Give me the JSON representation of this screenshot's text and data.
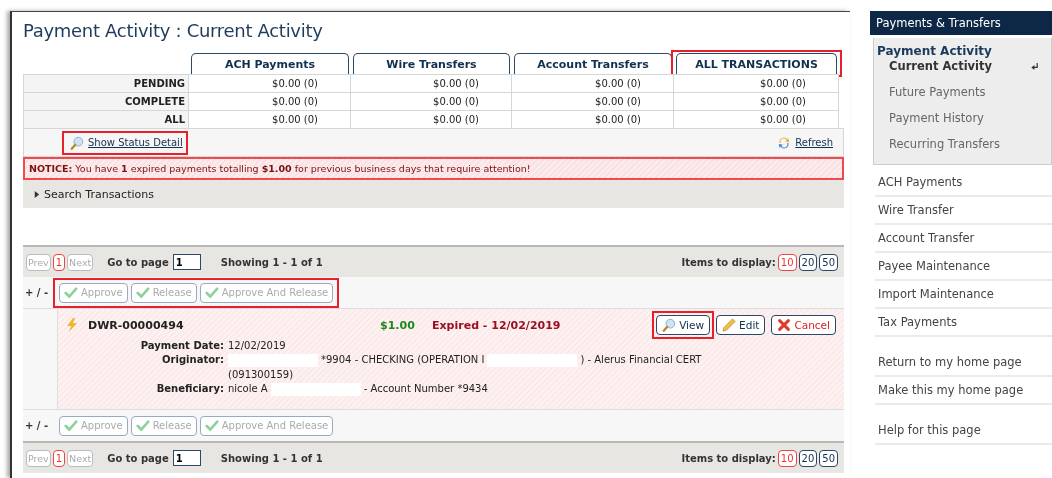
{
  "title": "Payment Activity : Current Activity",
  "summary": {
    "columns": [
      {
        "label": "ACH Payments",
        "highlighted": false
      },
      {
        "label": "Wire Transfers",
        "highlighted": false
      },
      {
        "label": "Account Transfers",
        "highlighted": false
      },
      {
        "label": "ALL TRANSACTIONS",
        "highlighted": true
      }
    ],
    "rows": [
      {
        "label": "PENDING",
        "cells": [
          "$0.00 (0)",
          "$0.00 (0)",
          "$0.00 (0)",
          "$0.00 (0)"
        ]
      },
      {
        "label": "COMPLETE",
        "cells": [
          "$0.00 (0)",
          "$0.00 (0)",
          "$0.00 (0)",
          "$0.00 (0)"
        ]
      },
      {
        "label": "ALL",
        "cells": [
          "$0.00 (0)",
          "$0.00 (0)",
          "$0.00 (0)",
          "$0.00 (0)"
        ]
      }
    ]
  },
  "status_link": {
    "label": "Show Status Detail",
    "highlighted": true
  },
  "refresh": "Refresh",
  "notice": "**NOTICE:** You have **1** expired payments totalling **$1.00** for previous business days that require attention!",
  "search": {
    "label": "Search Transactions",
    "expanded": false
  },
  "pager_top": {
    "pages": [
      {
        "label": "Prev",
        "kind": "nav",
        "disabled": true,
        "selected": false
      },
      {
        "label": "1",
        "kind": "page",
        "disabled": false,
        "selected": true
      },
      {
        "label": "Next",
        "kind": "nav",
        "disabled": true,
        "selected": false
      }
    ],
    "goto_label": "Go to page",
    "goto_value": "1",
    "showing": "Showing 1 - 1 of 1",
    "items_label": "Items to display:",
    "sizes": [
      {
        "label": "10",
        "selected": true
      },
      {
        "label": "20",
        "selected": false
      },
      {
        "label": "50",
        "selected": false
      }
    ]
  },
  "actions_top": {
    "toggle": "+ / -",
    "highlighted": true,
    "buttons": [
      {
        "label": "Approve",
        "disabled": true
      },
      {
        "label": "Release",
        "disabled": true
      },
      {
        "label": "Approve And Release",
        "disabled": true
      }
    ]
  },
  "payment": {
    "id": "DWR-00000494",
    "amount": "$1.00",
    "status": "Expired - 12/02/2019",
    "buttons": [
      {
        "label": "View",
        "kind": "view",
        "highlighted": true
      },
      {
        "label": "Edit",
        "kind": "edit",
        "highlighted": false
      },
      {
        "label": "Cancel",
        "kind": "cancel",
        "highlighted": false
      }
    ],
    "details": [
      {
        "label": "Payment Date:",
        "lines": [
          [
            {
              "kind": "text",
              "text": "12/02/2019"
            }
          ]
        ]
      },
      {
        "label": "Originator:",
        "lines": [
          [
            {
              "kind": "redaction"
            },
            {
              "kind": "text",
              "text": "*9904 - CHECKING (OPERATION I"
            },
            {
              "kind": "redaction"
            },
            {
              "kind": "text",
              "text": ") - Alerus Financial CERT"
            }
          ],
          [
            {
              "kind": "text",
              "text": "(091300159)"
            }
          ]
        ]
      },
      {
        "label": "Beneficiary:",
        "lines": [
          [
            {
              "kind": "text",
              "text": "nicole A"
            },
            {
              "kind": "redaction"
            },
            {
              "kind": "text",
              "text": "- Account Number *9434"
            }
          ]
        ]
      }
    ]
  },
  "actions_bottom": {
    "toggle": "+ / -",
    "highlighted": false,
    "buttons": [
      {
        "label": "Approve",
        "disabled": true
      },
      {
        "label": "Release",
        "disabled": true
      },
      {
        "label": "Approve And Release",
        "disabled": true
      }
    ]
  },
  "pager_bottom": {
    "pages": [
      {
        "label": "Prev",
        "kind": "nav",
        "disabled": true,
        "selected": false
      },
      {
        "label": "1",
        "kind": "page",
        "disabled": false,
        "selected": true
      },
      {
        "label": "Next",
        "kind": "nav",
        "disabled": true,
        "selected": false
      }
    ],
    "goto_label": "Go to page",
    "goto_value": "1",
    "showing": "Showing 1 - 1 of 1",
    "items_label": "Items to display:",
    "sizes": [
      {
        "label": "10",
        "selected": true
      },
      {
        "label": "20",
        "selected": false
      },
      {
        "label": "50",
        "selected": false
      }
    ]
  },
  "sidebar": {
    "header": "Payments & Transfers",
    "group": {
      "label": "Payment Activity",
      "items": [
        {
          "label": "Current Activity",
          "selected": true
        },
        {
          "label": "Future Payments",
          "selected": false
        },
        {
          "label": "Payment History",
          "selected": false
        },
        {
          "label": "Recurring Transfers",
          "selected": false
        }
      ]
    },
    "sections": [
      [
        "ACH Payments",
        "Wire Transfer",
        "Account Transfer",
        "Payee Maintenance",
        "Import Maintenance",
        "Tax Payments"
      ],
      [
        "Return to my home page",
        "Make this my home page"
      ],
      [
        "Help for this page"
      ]
    ]
  }
}
